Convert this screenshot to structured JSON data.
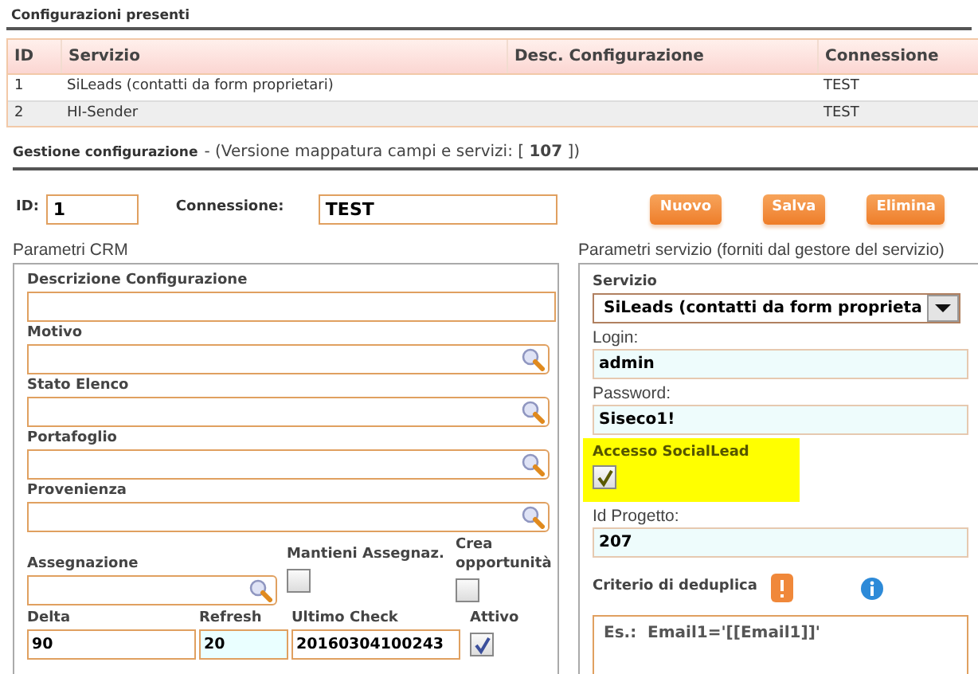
{
  "section_title": "Configurazioni presenti",
  "table": {
    "columns": [
      "ID",
      "Servizio",
      "Desc. Configurazione",
      "Connessione"
    ],
    "rows": [
      {
        "id": "1",
        "servizio": "SiLeads (contatti da form proprietari)",
        "connessione": "TEST"
      },
      {
        "id": "2",
        "servizio": "HI-Sender",
        "connessione": "TEST"
      }
    ]
  },
  "management": {
    "title": "Gestione configurazione",
    "subtitle": "- (Versione mappatura campi e servizi: [ **107** ])"
  },
  "form": {
    "id_label": "ID:",
    "id_value": "1",
    "connection_label": "Connessione:",
    "connection_value": "TEST",
    "buttons": [
      "Nuovo",
      "Salva",
      "Elimina"
    ]
  },
  "crm": {
    "title": "Parametri CRM",
    "fields": [
      {
        "kind": "text",
        "label": "Descrizione Configurazione"
      },
      {
        "kind": "lookup",
        "label": "Motivo"
      },
      {
        "kind": "lookup",
        "label": "Stato Elenco"
      },
      {
        "kind": "lookup",
        "label": "Portafoglio"
      },
      {
        "kind": "lookup",
        "label": "Provenienza"
      }
    ],
    "assign_label": "Assegnazione",
    "checks": [
      {
        "label": "Mantieni Assegnaz.",
        "checked": false
      },
      {
        "label": "Crea opportunità",
        "checked": false
      }
    ],
    "bottom": [
      {
        "kind": "input",
        "label": "Delta",
        "value": "90",
        "tinted": false
      },
      {
        "kind": "input",
        "label": "Refresh",
        "value": "20",
        "tinted": true
      },
      {
        "kind": "input",
        "label": "Ultimo Check",
        "value": "20160304100243",
        "tinted": false
      },
      {
        "kind": "checkbox",
        "label": "Attivo",
        "checked": true
      }
    ]
  },
  "service": {
    "title": "Parametri servizio (forniti dal gestore del servizio)",
    "servizio": {
      "label": "Servizio",
      "value": "SiLeads (contatti da form proprieta"
    },
    "login": {
      "label": "Login:",
      "value": "admin"
    },
    "password": {
      "label": "Password:",
      "value": "Siseco1!"
    },
    "social": {
      "label": "Accesso SocialLead",
      "checked": true,
      "highlighted": true
    },
    "project": {
      "label": "Id Progetto:",
      "value": "207"
    },
    "dedup": {
      "label": "Criterio di deduplica",
      "placeholder": "Es.:  Email1='[[Email1]]'"
    }
  }
}
